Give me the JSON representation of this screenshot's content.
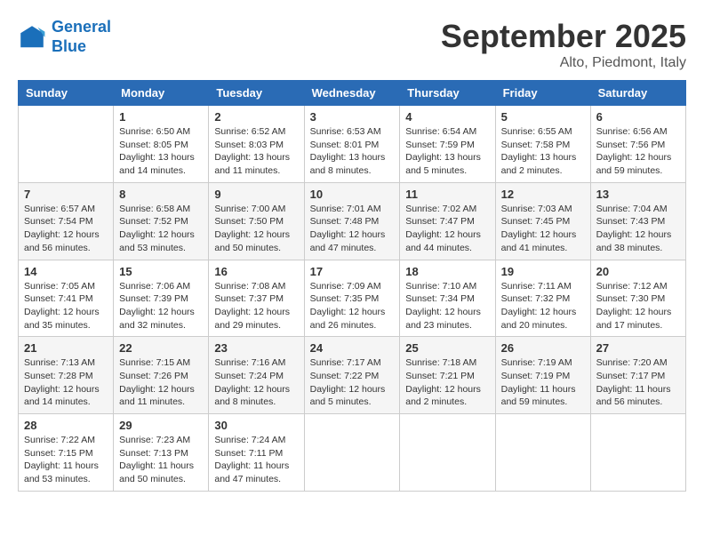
{
  "logo": {
    "line1": "General",
    "line2": "Blue"
  },
  "title": "September 2025",
  "location": "Alto, Piedmont, Italy",
  "days_of_week": [
    "Sunday",
    "Monday",
    "Tuesday",
    "Wednesday",
    "Thursday",
    "Friday",
    "Saturday"
  ],
  "weeks": [
    [
      {
        "num": "",
        "info": ""
      },
      {
        "num": "1",
        "info": "Sunrise: 6:50 AM\nSunset: 8:05 PM\nDaylight: 13 hours\nand 14 minutes."
      },
      {
        "num": "2",
        "info": "Sunrise: 6:52 AM\nSunset: 8:03 PM\nDaylight: 13 hours\nand 11 minutes."
      },
      {
        "num": "3",
        "info": "Sunrise: 6:53 AM\nSunset: 8:01 PM\nDaylight: 13 hours\nand 8 minutes."
      },
      {
        "num": "4",
        "info": "Sunrise: 6:54 AM\nSunset: 7:59 PM\nDaylight: 13 hours\nand 5 minutes."
      },
      {
        "num": "5",
        "info": "Sunrise: 6:55 AM\nSunset: 7:58 PM\nDaylight: 13 hours\nand 2 minutes."
      },
      {
        "num": "6",
        "info": "Sunrise: 6:56 AM\nSunset: 7:56 PM\nDaylight: 12 hours\nand 59 minutes."
      }
    ],
    [
      {
        "num": "7",
        "info": "Sunrise: 6:57 AM\nSunset: 7:54 PM\nDaylight: 12 hours\nand 56 minutes."
      },
      {
        "num": "8",
        "info": "Sunrise: 6:58 AM\nSunset: 7:52 PM\nDaylight: 12 hours\nand 53 minutes."
      },
      {
        "num": "9",
        "info": "Sunrise: 7:00 AM\nSunset: 7:50 PM\nDaylight: 12 hours\nand 50 minutes."
      },
      {
        "num": "10",
        "info": "Sunrise: 7:01 AM\nSunset: 7:48 PM\nDaylight: 12 hours\nand 47 minutes."
      },
      {
        "num": "11",
        "info": "Sunrise: 7:02 AM\nSunset: 7:47 PM\nDaylight: 12 hours\nand 44 minutes."
      },
      {
        "num": "12",
        "info": "Sunrise: 7:03 AM\nSunset: 7:45 PM\nDaylight: 12 hours\nand 41 minutes."
      },
      {
        "num": "13",
        "info": "Sunrise: 7:04 AM\nSunset: 7:43 PM\nDaylight: 12 hours\nand 38 minutes."
      }
    ],
    [
      {
        "num": "14",
        "info": "Sunrise: 7:05 AM\nSunset: 7:41 PM\nDaylight: 12 hours\nand 35 minutes."
      },
      {
        "num": "15",
        "info": "Sunrise: 7:06 AM\nSunset: 7:39 PM\nDaylight: 12 hours\nand 32 minutes."
      },
      {
        "num": "16",
        "info": "Sunrise: 7:08 AM\nSunset: 7:37 PM\nDaylight: 12 hours\nand 29 minutes."
      },
      {
        "num": "17",
        "info": "Sunrise: 7:09 AM\nSunset: 7:35 PM\nDaylight: 12 hours\nand 26 minutes."
      },
      {
        "num": "18",
        "info": "Sunrise: 7:10 AM\nSunset: 7:34 PM\nDaylight: 12 hours\nand 23 minutes."
      },
      {
        "num": "19",
        "info": "Sunrise: 7:11 AM\nSunset: 7:32 PM\nDaylight: 12 hours\nand 20 minutes."
      },
      {
        "num": "20",
        "info": "Sunrise: 7:12 AM\nSunset: 7:30 PM\nDaylight: 12 hours\nand 17 minutes."
      }
    ],
    [
      {
        "num": "21",
        "info": "Sunrise: 7:13 AM\nSunset: 7:28 PM\nDaylight: 12 hours\nand 14 minutes."
      },
      {
        "num": "22",
        "info": "Sunrise: 7:15 AM\nSunset: 7:26 PM\nDaylight: 12 hours\nand 11 minutes."
      },
      {
        "num": "23",
        "info": "Sunrise: 7:16 AM\nSunset: 7:24 PM\nDaylight: 12 hours\nand 8 minutes."
      },
      {
        "num": "24",
        "info": "Sunrise: 7:17 AM\nSunset: 7:22 PM\nDaylight: 12 hours\nand 5 minutes."
      },
      {
        "num": "25",
        "info": "Sunrise: 7:18 AM\nSunset: 7:21 PM\nDaylight: 12 hours\nand 2 minutes."
      },
      {
        "num": "26",
        "info": "Sunrise: 7:19 AM\nSunset: 7:19 PM\nDaylight: 11 hours\nand 59 minutes."
      },
      {
        "num": "27",
        "info": "Sunrise: 7:20 AM\nSunset: 7:17 PM\nDaylight: 11 hours\nand 56 minutes."
      }
    ],
    [
      {
        "num": "28",
        "info": "Sunrise: 7:22 AM\nSunset: 7:15 PM\nDaylight: 11 hours\nand 53 minutes."
      },
      {
        "num": "29",
        "info": "Sunrise: 7:23 AM\nSunset: 7:13 PM\nDaylight: 11 hours\nand 50 minutes."
      },
      {
        "num": "30",
        "info": "Sunrise: 7:24 AM\nSunset: 7:11 PM\nDaylight: 11 hours\nand 47 minutes."
      },
      {
        "num": "",
        "info": ""
      },
      {
        "num": "",
        "info": ""
      },
      {
        "num": "",
        "info": ""
      },
      {
        "num": "",
        "info": ""
      }
    ]
  ]
}
